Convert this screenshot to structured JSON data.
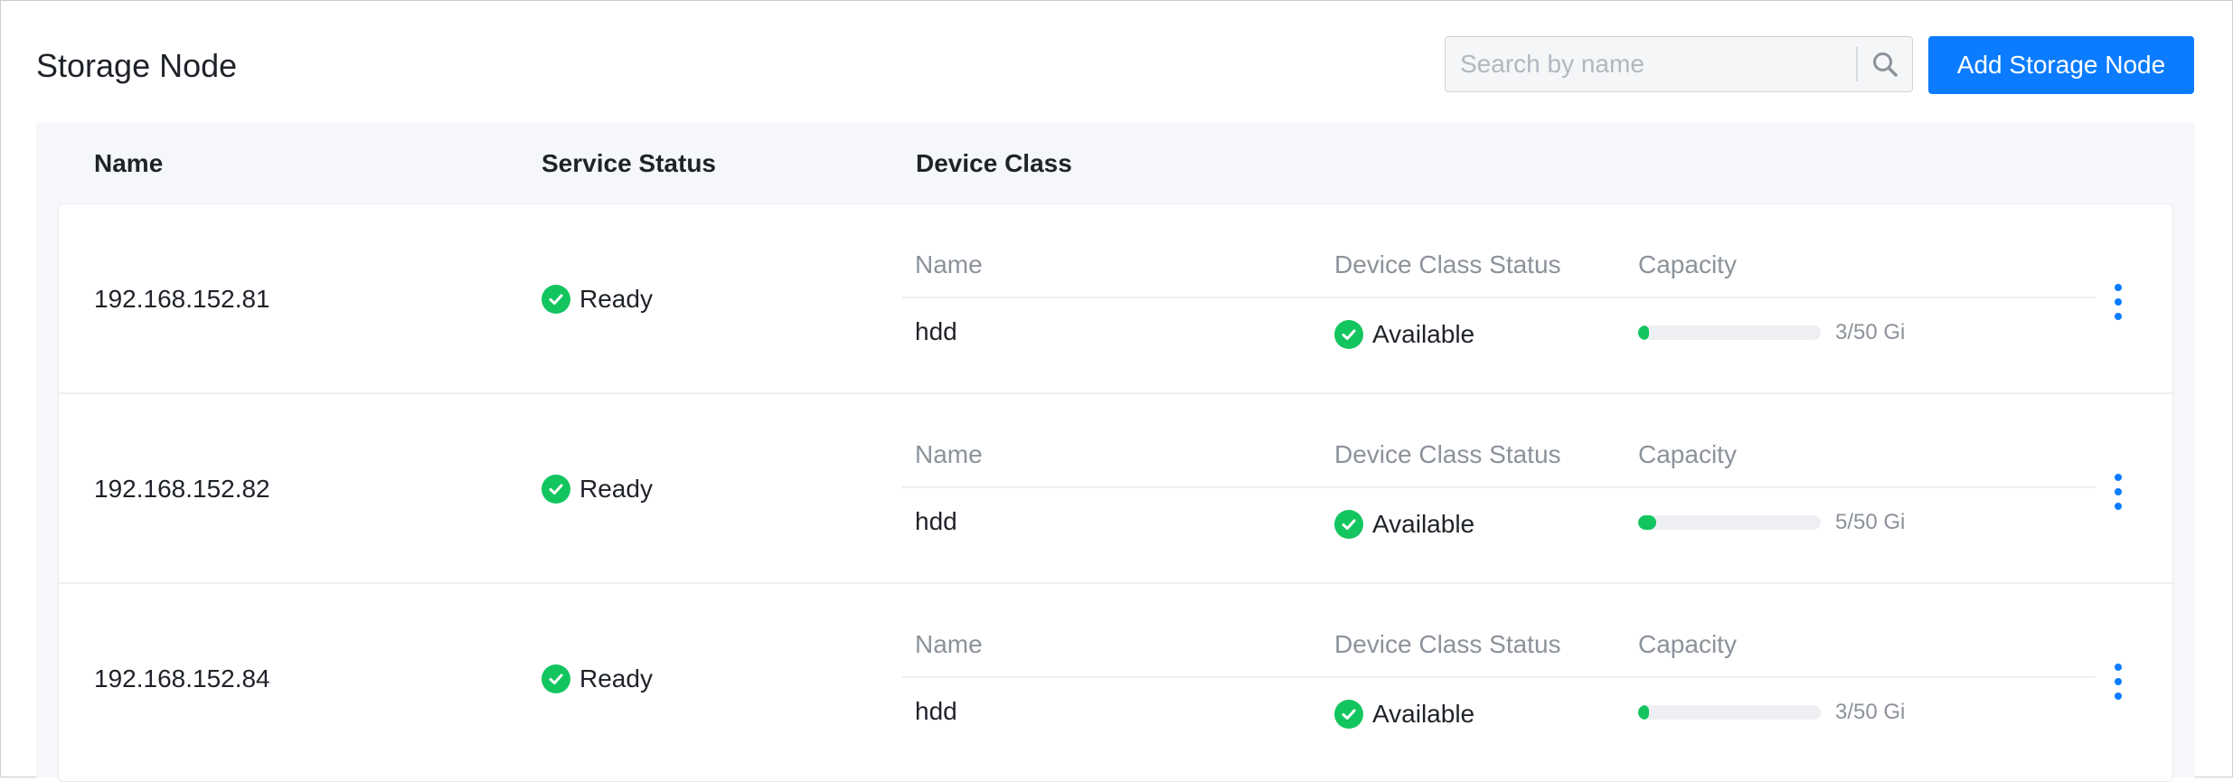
{
  "header": {
    "title": "Storage Node",
    "search_placeholder": "Search by name",
    "search_value": "",
    "add_button_label": "Add Storage Node"
  },
  "table": {
    "columns": [
      "Name",
      "Service Status",
      "Device Class"
    ],
    "device_class_columns": [
      "Name",
      "Device Class Status",
      "Capacity"
    ],
    "rows": [
      {
        "name": "192.168.152.81",
        "service_status": "Ready",
        "device_class": {
          "name": "hdd",
          "status": "Available",
          "capacity_used": 3,
          "capacity_total": 50,
          "capacity_text": "3/50 Gi"
        }
      },
      {
        "name": "192.168.152.82",
        "service_status": "Ready",
        "device_class": {
          "name": "hdd",
          "status": "Available",
          "capacity_used": 5,
          "capacity_total": 50,
          "capacity_text": "5/50 Gi"
        }
      },
      {
        "name": "192.168.152.84",
        "service_status": "Ready",
        "device_class": {
          "name": "hdd",
          "status": "Available",
          "capacity_used": 3,
          "capacity_total": 50,
          "capacity_text": "3/50 Gi"
        }
      }
    ]
  },
  "colors": {
    "accent": "#0b7cff",
    "success": "#13c55e",
    "muted_text": "#8c929a",
    "table_header_bg": "#f5f7fa"
  },
  "icons": {
    "search": "search-icon",
    "status": "check-circle-icon",
    "row_actions": "more-vertical-icon"
  }
}
